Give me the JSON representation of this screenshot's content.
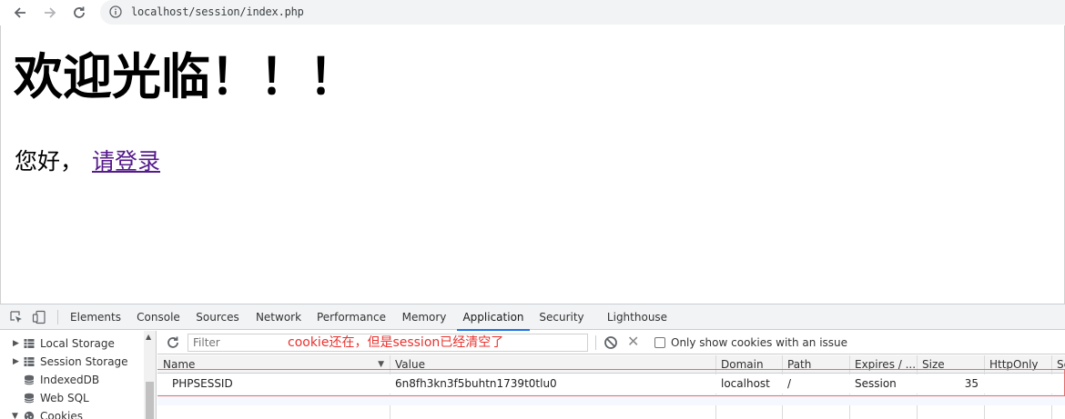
{
  "browser": {
    "url": "localhost/session/index.php"
  },
  "page": {
    "heading": "欢迎光临！！！",
    "greeting": "您好，",
    "login_link": "请登录"
  },
  "devtools": {
    "tabs": [
      {
        "label": "Elements"
      },
      {
        "label": "Console"
      },
      {
        "label": "Sources"
      },
      {
        "label": "Network"
      },
      {
        "label": "Performance"
      },
      {
        "label": "Memory"
      },
      {
        "label": "Application",
        "active": true
      },
      {
        "label": "Security"
      },
      {
        "label": "Lighthouse"
      }
    ],
    "sidebar": [
      {
        "label": "Local Storage",
        "icon": "grid-icon",
        "expander": "collapsed"
      },
      {
        "label": "Session Storage",
        "icon": "grid-icon",
        "expander": "collapsed"
      },
      {
        "label": "IndexedDB",
        "icon": "database-icon"
      },
      {
        "label": "Web SQL",
        "icon": "database-icon"
      },
      {
        "label": "Cookies",
        "icon": "cookie-icon",
        "expander": "expanded"
      }
    ],
    "toolbar": {
      "filter_placeholder": "Filter",
      "only_issues_label": "Only show cookies with an issue",
      "only_issues_checked": false
    },
    "annotation": "cookie还在，但是session已经清空了",
    "annotation_color": "#e8322e",
    "table": {
      "columns": [
        "Name",
        "Value",
        "Domain",
        "Path",
        "Expires / ...",
        "Size",
        "HttpOnly",
        "Se"
      ],
      "rows": [
        [
          "PHPSESSID",
          "6n8fh3kn3f5buhtn1739t0tlu0",
          "localhost",
          "/",
          "Session",
          "35",
          "",
          ""
        ]
      ]
    }
  }
}
